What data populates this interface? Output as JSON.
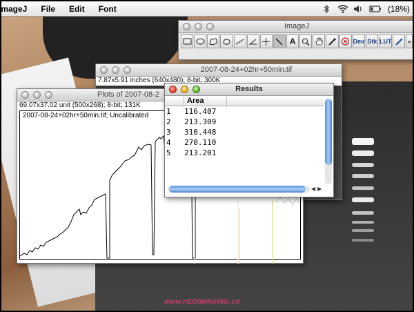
{
  "menubar": {
    "app_name": "ImageJ",
    "menus": [
      "File",
      "Edit",
      "Font"
    ],
    "battery": "(18%)"
  },
  "toolbar_window": {
    "title": "ImageJ",
    "tools": [
      "rect",
      "oval",
      "poly",
      "free",
      "line",
      "angle",
      "point",
      "wand",
      "A",
      "zoom",
      "hand",
      "dropper",
      "X",
      "Dev",
      "Stk",
      "LUT",
      "pen",
      "more"
    ]
  },
  "image_window": {
    "title": "2007-08-24+02hr+50min.tif",
    "info": "7.87x5.91 inches (640x480); 8-bit; 300K"
  },
  "plot_window": {
    "title": "Plots of 2007-08-2",
    "info": "69.07x37.02 unit (500x268); 8-bit; 131K",
    "subtitle": "2007-08-24+02hr+50min.tif; Uncalibrated"
  },
  "results_window": {
    "title": "Results",
    "column_header": "Area",
    "rows": [
      {
        "n": "1",
        "area": "116.407"
      },
      {
        "n": "2",
        "area": "213.309"
      },
      {
        "n": "3",
        "area": "310.448"
      },
      {
        "n": "4",
        "area": "270.110"
      },
      {
        "n": "5",
        "area": "213.201"
      }
    ]
  },
  "watermark": "www.nEOIMAGING.cn"
}
